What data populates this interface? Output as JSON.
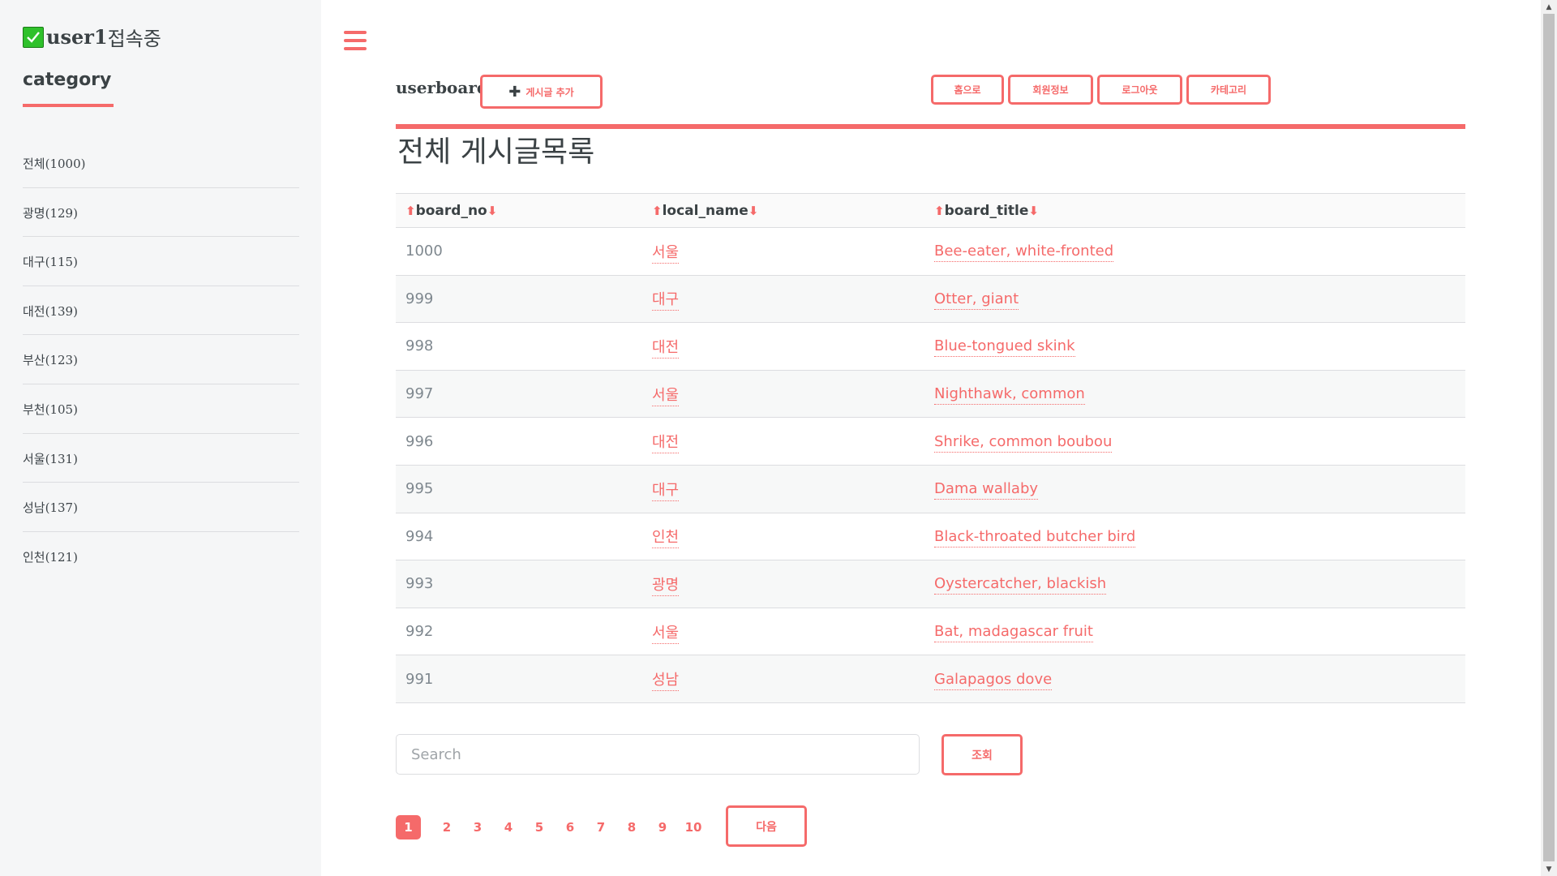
{
  "sidebar": {
    "user_name": "user1",
    "user_status_suffix": "접속중",
    "category_title": "category",
    "items": [
      {
        "label": "전체(1000)"
      },
      {
        "label": "광명(129)"
      },
      {
        "label": "대구(115)"
      },
      {
        "label": "대전(139)"
      },
      {
        "label": "부산(123)"
      },
      {
        "label": "부천(105)"
      },
      {
        "label": "서울(131)"
      },
      {
        "label": "성남(137)"
      },
      {
        "label": "인천(121)"
      }
    ]
  },
  "header": {
    "brand": "userboard",
    "add_post_label": "게시글 추가",
    "nav": {
      "home": "홈으로",
      "member_info": "회원정보",
      "logout": "로그아웃",
      "category": "카테고리"
    }
  },
  "main": {
    "title": "전체 게시글목록",
    "table": {
      "columns": [
        "board_no",
        "local_name",
        "board_title"
      ],
      "rows": [
        {
          "board_no": "1000",
          "local_name": "서울",
          "board_title": "Bee-eater, white-fronted"
        },
        {
          "board_no": "999",
          "local_name": "대구",
          "board_title": "Otter, giant"
        },
        {
          "board_no": "998",
          "local_name": "대전",
          "board_title": "Blue-tongued skink"
        },
        {
          "board_no": "997",
          "local_name": "서울",
          "board_title": "Nighthawk, common"
        },
        {
          "board_no": "996",
          "local_name": "대전",
          "board_title": "Shrike, common boubou"
        },
        {
          "board_no": "995",
          "local_name": "대구",
          "board_title": "Dama wallaby"
        },
        {
          "board_no": "994",
          "local_name": "인천",
          "board_title": "Black-throated butcher bird"
        },
        {
          "board_no": "993",
          "local_name": "광명",
          "board_title": "Oystercatcher, blackish"
        },
        {
          "board_no": "992",
          "local_name": "서울",
          "board_title": "Bat, madagascar fruit"
        },
        {
          "board_no": "991",
          "local_name": "성남",
          "board_title": "Galapagos dove"
        }
      ]
    },
    "search": {
      "placeholder": "Search",
      "value": "",
      "button_label": "조회"
    },
    "pagination": {
      "pages": [
        "1",
        "2",
        "3",
        "4",
        "5",
        "6",
        "7",
        "8",
        "9",
        "10"
      ],
      "current": "1",
      "next_label": "다음"
    }
  },
  "colors": {
    "accent": "#f56a6a",
    "sidebar_bg": "#f5f6f7",
    "text": "#3b4245",
    "check": "#2fc12b"
  },
  "icons": {
    "menu": "hamburger-menu-icon",
    "check": "checkbox-checked-icon",
    "add": "plus-icon",
    "sort_up": "arrow-up-icon",
    "sort_down": "arrow-down-icon"
  }
}
